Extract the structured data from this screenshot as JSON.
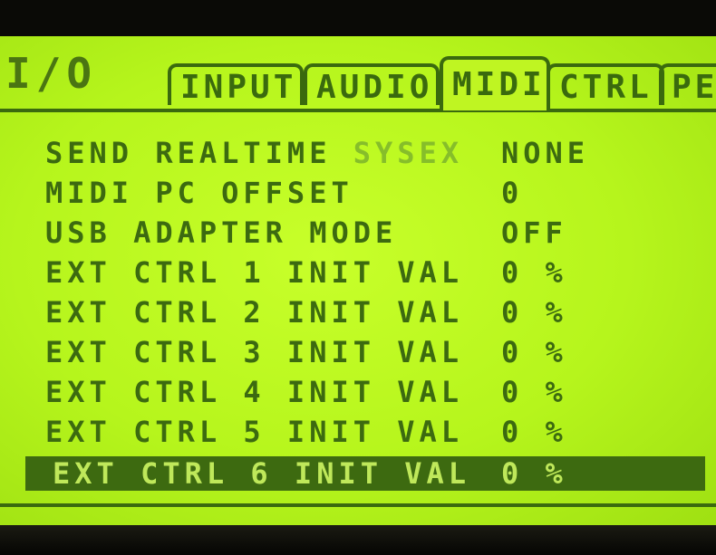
{
  "page": {
    "title": "I/O"
  },
  "tabs": [
    {
      "label": "INPUT",
      "active": false
    },
    {
      "label": "AUDIO",
      "active": false
    },
    {
      "label": "MIDI",
      "active": true
    },
    {
      "label": "CTRL",
      "active": false
    },
    {
      "label": "PED",
      "active": false
    }
  ],
  "params": [
    {
      "label": "SEND REALTIME",
      "label_dim": "SYSEX",
      "value": "NONE"
    },
    {
      "label": "MIDI PC OFFSET",
      "label_dim": "",
      "value": "0"
    },
    {
      "label": "USB ADAPTER MODE",
      "label_dim": "",
      "value": "OFF"
    },
    {
      "label": "EXT CTRL 1 INIT VAL",
      "label_dim": "",
      "value": "0 %"
    },
    {
      "label": "EXT CTRL 2 INIT VAL",
      "label_dim": "",
      "value": "0 %"
    },
    {
      "label": "EXT CTRL 3 INIT VAL",
      "label_dim": "",
      "value": "0 %"
    },
    {
      "label": "EXT CTRL 4 INIT VAL",
      "label_dim": "",
      "value": "0 %"
    },
    {
      "label": "EXT CTRL 5 INIT VAL",
      "label_dim": "",
      "value": "0 %"
    },
    {
      "label": "EXT CTRL 6 INIT VAL",
      "label_dim": "",
      "value": "0 %"
    }
  ],
  "selected_index": 8,
  "colors": {
    "lcd_background": "#b6f51c",
    "lcd_text": "#3c6a10",
    "selection_bar": "#3d6a10"
  }
}
